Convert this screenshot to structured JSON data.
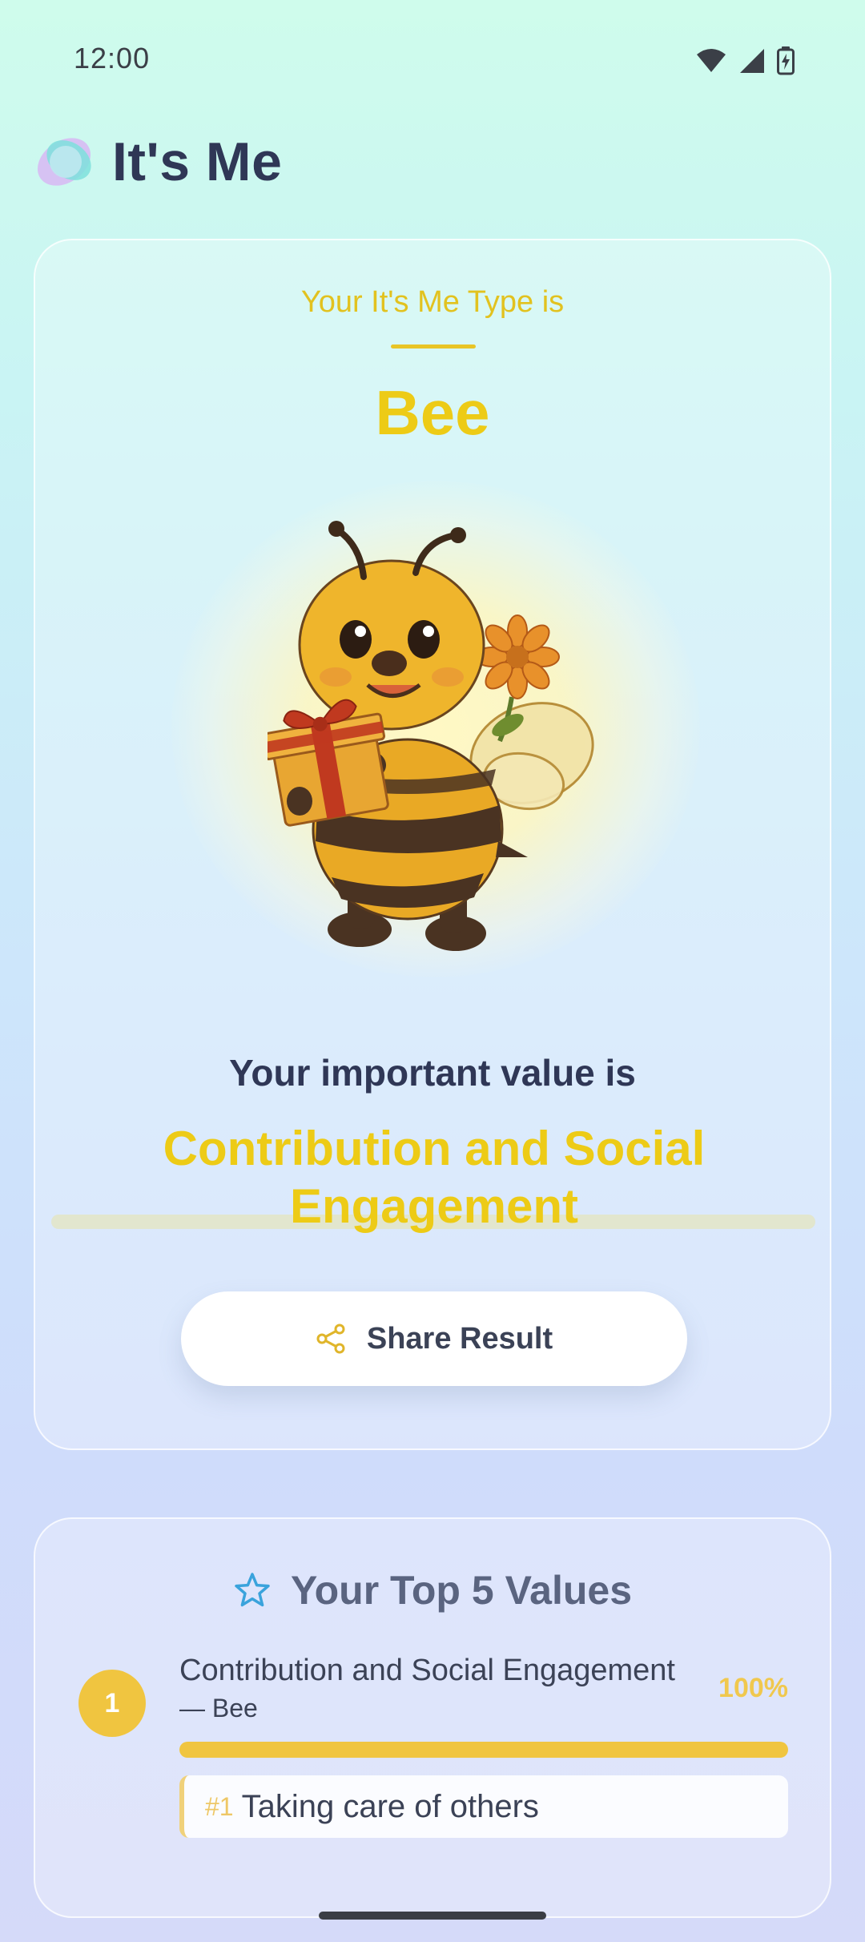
{
  "status_bar": {
    "time": "12:00",
    "icons": [
      "wifi-icon",
      "signal-icon",
      "battery-charging-icon"
    ]
  },
  "app": {
    "title": "It's Me",
    "logo": "its-me-logo"
  },
  "result": {
    "caption": "Your It's Me Type is",
    "type_name": "Bee",
    "illustration": "bee-holding-gift-illustration",
    "value_caption": "Your important value is",
    "value_name": "Contribution and Social Engagement",
    "share_label": "Share Result",
    "share_icon": "share-icon"
  },
  "top_values": {
    "title": "Your Top 5 Values",
    "title_icon": "star-icon",
    "items": [
      {
        "rank": "1",
        "title": "Contribution and Social Engagement",
        "subtitle": "— Bee",
        "percent": "100%",
        "progress": 1.0,
        "detail_rank": "#1",
        "detail_label": "Taking care of others"
      }
    ]
  },
  "colors": {
    "accent_yellow": "#edcb16",
    "badge_yellow": "#f0c540",
    "text_dark": "#2f3756"
  }
}
